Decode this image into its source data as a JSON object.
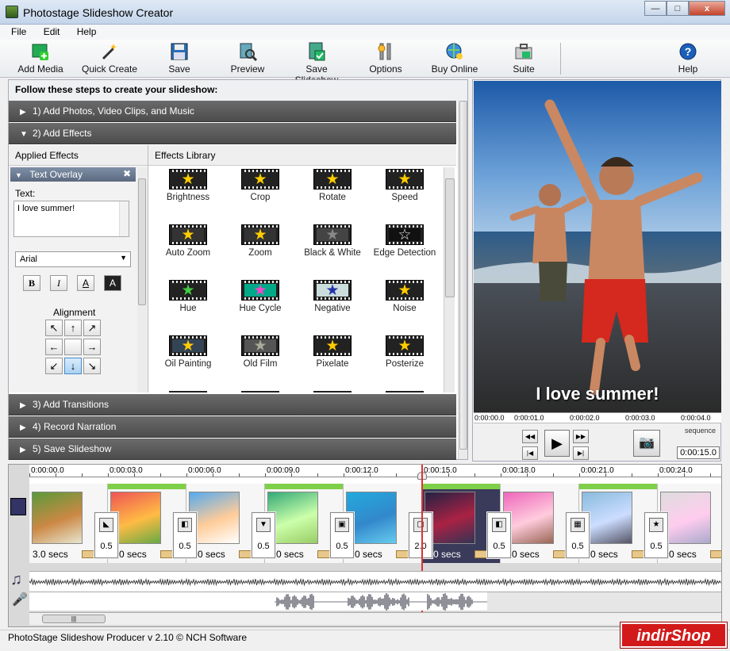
{
  "window": {
    "title": "Photostage Slideshow Creator",
    "min": "—",
    "max": "□",
    "close": "x"
  },
  "menu": [
    "File",
    "Edit",
    "Help"
  ],
  "toolbar": [
    {
      "label": "Add Media",
      "icon": "add-media-icon"
    },
    {
      "label": "Quick Create",
      "icon": "magic-wand-icon"
    },
    {
      "label": "Save",
      "icon": "floppy-disk-icon"
    },
    {
      "label": "Preview",
      "icon": "preview-icon"
    },
    {
      "label": "Save Slideshow",
      "icon": "save-slideshow-icon"
    },
    {
      "label": "Options",
      "icon": "options-icon"
    },
    {
      "label": "Buy Online",
      "icon": "buy-online-icon"
    },
    {
      "label": "Suite",
      "icon": "suite-icon"
    },
    {
      "label": "Help",
      "icon": "help-icon"
    }
  ],
  "steps": {
    "header": "Follow these steps to create your slideshow:",
    "items": [
      "1)  Add Photos, Video Clips, and Music",
      "2)  Add Effects",
      "3)  Add Transitions",
      "4)  Record Narration",
      "5)  Save Slideshow"
    ]
  },
  "applied": {
    "header": "Applied Effects",
    "overlay_title": "Text Overlay",
    "text_label": "Text:",
    "text_value": "I love summer!",
    "font": "Arial",
    "format_buttons": [
      "B",
      "I",
      "A",
      "A"
    ],
    "alignment_label": "Alignment",
    "alignment": [
      "↖",
      "↑",
      "↗",
      "←",
      "",
      "→",
      "↙",
      "↓",
      "↘"
    ]
  },
  "library": {
    "header": "Effects Library",
    "effects": [
      "Brightness",
      "Crop",
      "Rotate",
      "Speed",
      "Auto Zoom",
      "Zoom",
      "Black & White",
      "Edge Detection",
      "Hue",
      "Hue Cycle",
      "Negative",
      "Noise",
      "Oil Painting",
      "Old Film",
      "Pixelate",
      "Posterize"
    ]
  },
  "preview": {
    "caption": "I love summer!",
    "ruler": [
      "0:00:00.0",
      "0:00:01.0",
      "0:00:02.0",
      "0:00:03.0",
      "0:00:04.0"
    ],
    "sequence_label": "sequence",
    "timecode": "0:00:15.0"
  },
  "timeline": {
    "ruler": [
      "0:00:00.0",
      "0:00:03.0",
      "0:00:06.0",
      "0:00:09.0",
      "0:00:12.0",
      "0:00:15.0",
      "0:00:18.0",
      "0:00:21.0",
      "0:00:24.0"
    ],
    "clips": [
      "3.0 secs",
      "3.0 secs",
      "3.0 secs",
      "3.0 secs",
      "3.0 secs",
      "3.0 secs",
      "3.0 secs",
      "3.0 secs",
      "3.0 secs"
    ],
    "transitions": [
      "0.5",
      "0.5",
      "0.5",
      "0.5",
      "2.0",
      "0.5",
      "0.5",
      "0.5"
    ]
  },
  "status": {
    "text": "PhotoStage Slideshow Producer v 2.10 © NCH Software",
    "watermark": "indirShop"
  },
  "colors": {
    "accent": "#7fcf48",
    "playhead": "#d33333",
    "step_bar": "#5a5a5a",
    "watermark": "#d21a1a"
  }
}
